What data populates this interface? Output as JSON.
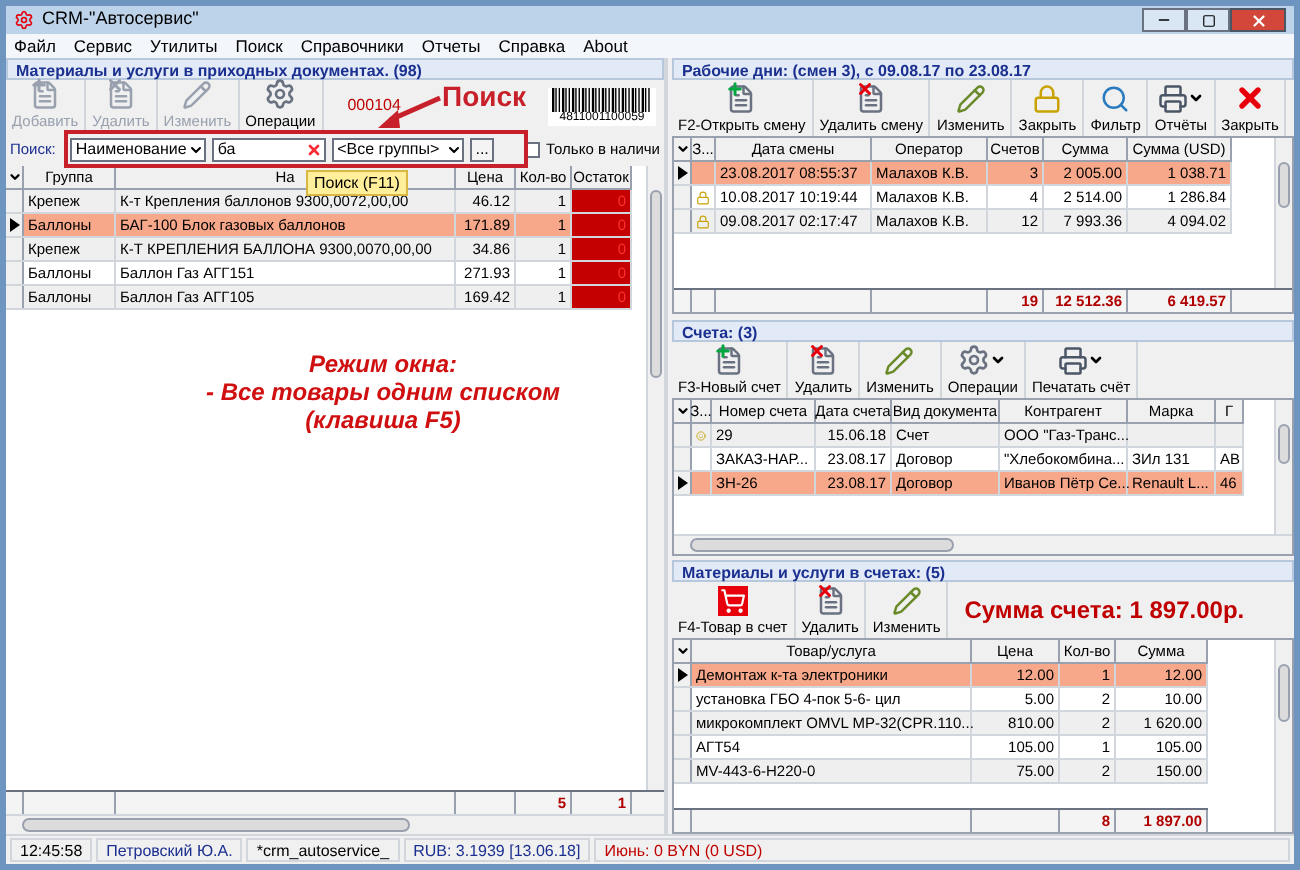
{
  "window": {
    "title": "CRM-\"Автосервис\""
  },
  "menu": [
    "Файл",
    "Сервис",
    "Утилиты",
    "Поиск",
    "Справочники",
    "Отчеты",
    "Справка",
    "About"
  ],
  "left": {
    "title": "Материалы и услуги в приходных документах. (98)",
    "toolbar": [
      {
        "label": "Добавить",
        "kind": "add",
        "disabled": true
      },
      {
        "label": "Удалить",
        "kind": "delete",
        "disabled": true
      },
      {
        "label": "Изменить",
        "kind": "edit",
        "disabled": true
      },
      {
        "label": "Операции",
        "kind": "operations",
        "disabled": false
      }
    ],
    "doc_number": "000104",
    "barcode_number": "4811001100059",
    "search": {
      "label": "Поиск:",
      "field": "Наименование",
      "value": "ба",
      "group": "<Все группы>",
      "more": "...",
      "in_stock": {
        "label": "Только в наличи",
        "checked": false
      }
    },
    "annotation": "Поиск",
    "tooltip": "Поиск (F11)",
    "table": {
      "columns": [
        {
          "label": "Группа"
        },
        {
          "label": "На"
        },
        {
          "label": "Цена"
        },
        {
          "label": "Кол-во"
        },
        {
          "label": "Остаток"
        }
      ],
      "rows": [
        {
          "selected": false,
          "cells": [
            "Крепеж",
            "К-т Крепления баллонов 9300,0072,00,00",
            "46.12",
            "1",
            "0"
          ]
        },
        {
          "selected": true,
          "cells": [
            "Баллоны",
            "БАГ-100 Блок газовых баллонов",
            "171.89",
            "1",
            "0"
          ]
        },
        {
          "selected": false,
          "cells": [
            "Крепеж",
            "К-Т КРЕПЛЕНИЯ БАЛЛОНА 9300,0070,00,00",
            "34.86",
            "1",
            "0"
          ]
        },
        {
          "selected": false,
          "cells": [
            "Баллоны",
            "Баллон Газ АГГ151",
            "271.93",
            "1",
            "0"
          ]
        },
        {
          "selected": false,
          "cells": [
            "Баллоны",
            "Баллон Газ АГГ105",
            "169.42",
            "1",
            "0"
          ]
        }
      ],
      "totals": [
        "5",
        "1"
      ]
    },
    "note": [
      "Режим окна:",
      "- Все товары одним списком",
      "(клавиша F5)"
    ]
  },
  "days": {
    "title": "Рабочие дни: (смен 3), с 09.08.17 по 23.08.17",
    "toolbar": [
      {
        "label": "F2-Открыть смену",
        "kind": "add",
        "dropdown": false
      },
      {
        "label": "Удалить смену",
        "kind": "delete",
        "dropdown": false
      },
      {
        "label": "Изменить",
        "kind": "edit",
        "dropdown": false
      },
      {
        "label": "Закрыть",
        "kind": "lock",
        "dropdown": false
      },
      {
        "label": "Фильтр",
        "kind": "filter",
        "dropdown": false
      },
      {
        "label": "Отчёты",
        "kind": "print",
        "dropdown": true
      },
      {
        "label": "Закрыть",
        "kind": "close",
        "dropdown": false
      }
    ],
    "table": {
      "columns": [
        {
          "label": "З..."
        },
        {
          "label": "Дата смены"
        },
        {
          "label": "Оператор"
        },
        {
          "label": "Счетов"
        },
        {
          "label": "Сумма"
        },
        {
          "label": "Сумма (USD)"
        }
      ],
      "rows": [
        {
          "selected": true,
          "locked": false,
          "cells": [
            "",
            "23.08.2017 08:55:37",
            "Малахов К.В.",
            "3",
            "2 005.00",
            "1 038.71"
          ]
        },
        {
          "selected": false,
          "locked": true,
          "cells": [
            "",
            "10.08.2017 10:19:44",
            "Малахов К.В.",
            "4",
            "2 514.00",
            "1 286.84"
          ]
        },
        {
          "selected": false,
          "locked": true,
          "cells": [
            "",
            "09.08.2017 02:17:47",
            "Малахов К.В.",
            "12",
            "7 993.36",
            "4 094.02"
          ]
        }
      ],
      "totals": [
        "19",
        "12 512.36",
        "6 419.57"
      ]
    }
  },
  "invoices": {
    "title": "Счета: (3)",
    "toolbar": [
      {
        "label": "F3-Новый счет",
        "kind": "add",
        "dropdown": false
      },
      {
        "label": "Удалить",
        "kind": "delete",
        "dropdown": false
      },
      {
        "label": "Изменить",
        "kind": "edit",
        "dropdown": false
      },
      {
        "label": "Операции",
        "kind": "operations",
        "dropdown": true
      },
      {
        "label": "Печатать счёт",
        "kind": "print",
        "dropdown": true
      }
    ],
    "table": {
      "columns": [
        {
          "label": "З..."
        },
        {
          "label": "Номер счета"
        },
        {
          "label": "Дата счета"
        },
        {
          "label": "Вид документа"
        },
        {
          "label": "Контрагент"
        },
        {
          "label": "Марка"
        },
        {
          "label": "Г"
        }
      ],
      "rows": [
        {
          "selected": false,
          "flagged": true,
          "cells": [
            "",
            "29",
            "15.06.18",
            "Счет",
            "ООО \"Газ-Транс...",
            "",
            ""
          ]
        },
        {
          "selected": false,
          "flagged": false,
          "cells": [
            "",
            "ЗАКАЗ-НАР...",
            "23.08.17",
            "Договор",
            "\"Хлебокомбина...",
            "ЗИл 131",
            "АВ"
          ]
        },
        {
          "selected": true,
          "flagged": false,
          "cells": [
            "",
            "ЗН-26",
            "23.08.17",
            "Договор",
            "Иванов Пётр Се...",
            "Renault L...",
            "46"
          ]
        }
      ]
    }
  },
  "items": {
    "title": "Материалы и услуги в счетах: (5)",
    "toolbar": [
      {
        "label": "F4-Товар в счет",
        "kind": "cart",
        "dropdown": false
      },
      {
        "label": "Удалить",
        "kind": "delete",
        "dropdown": false
      },
      {
        "label": "Изменить",
        "kind": "edit",
        "dropdown": false
      }
    ],
    "invoice_sum": "Сумма счета: 1 897.00р.",
    "table": {
      "columns": [
        {
          "label": "Товар/услуга"
        },
        {
          "label": "Цена"
        },
        {
          "label": "Кол-во"
        },
        {
          "label": "Сумма"
        }
      ],
      "rows": [
        {
          "selected": true,
          "cells": [
            "Демонтаж к-та электроники",
            "12.00",
            "1",
            "12.00"
          ]
        },
        {
          "selected": false,
          "cells": [
            "установка ГБО 4-пок 5-6- цил",
            "5.00",
            "2",
            "10.00"
          ]
        },
        {
          "selected": false,
          "cells": [
            "микрокомплект OMVL MP-32(CPR.110...",
            "810.00",
            "2",
            "1 620.00"
          ]
        },
        {
          "selected": false,
          "cells": [
            "АГТ54",
            "105.00",
            "1",
            "105.00"
          ]
        },
        {
          "selected": false,
          "cells": [
            "MV-443-6-H220-0",
            "75.00",
            "2",
            "150.00"
          ]
        }
      ],
      "totals": [
        "8",
        "1 897.00"
      ]
    }
  },
  "status_bar": [
    {
      "text": "12:45:58",
      "color": "#000000"
    },
    {
      "text": "Петровский Ю.А.",
      "color": "#1a2f8f"
    },
    {
      "text": "*crm_autoservice_",
      "color": "#000000"
    },
    {
      "text": "RUB: 3.1939 [13.06.18]",
      "color": "#1a2f8f"
    },
    {
      "text": "Июнь: 0 BYN (0 USD)",
      "color": "#c00000"
    }
  ]
}
